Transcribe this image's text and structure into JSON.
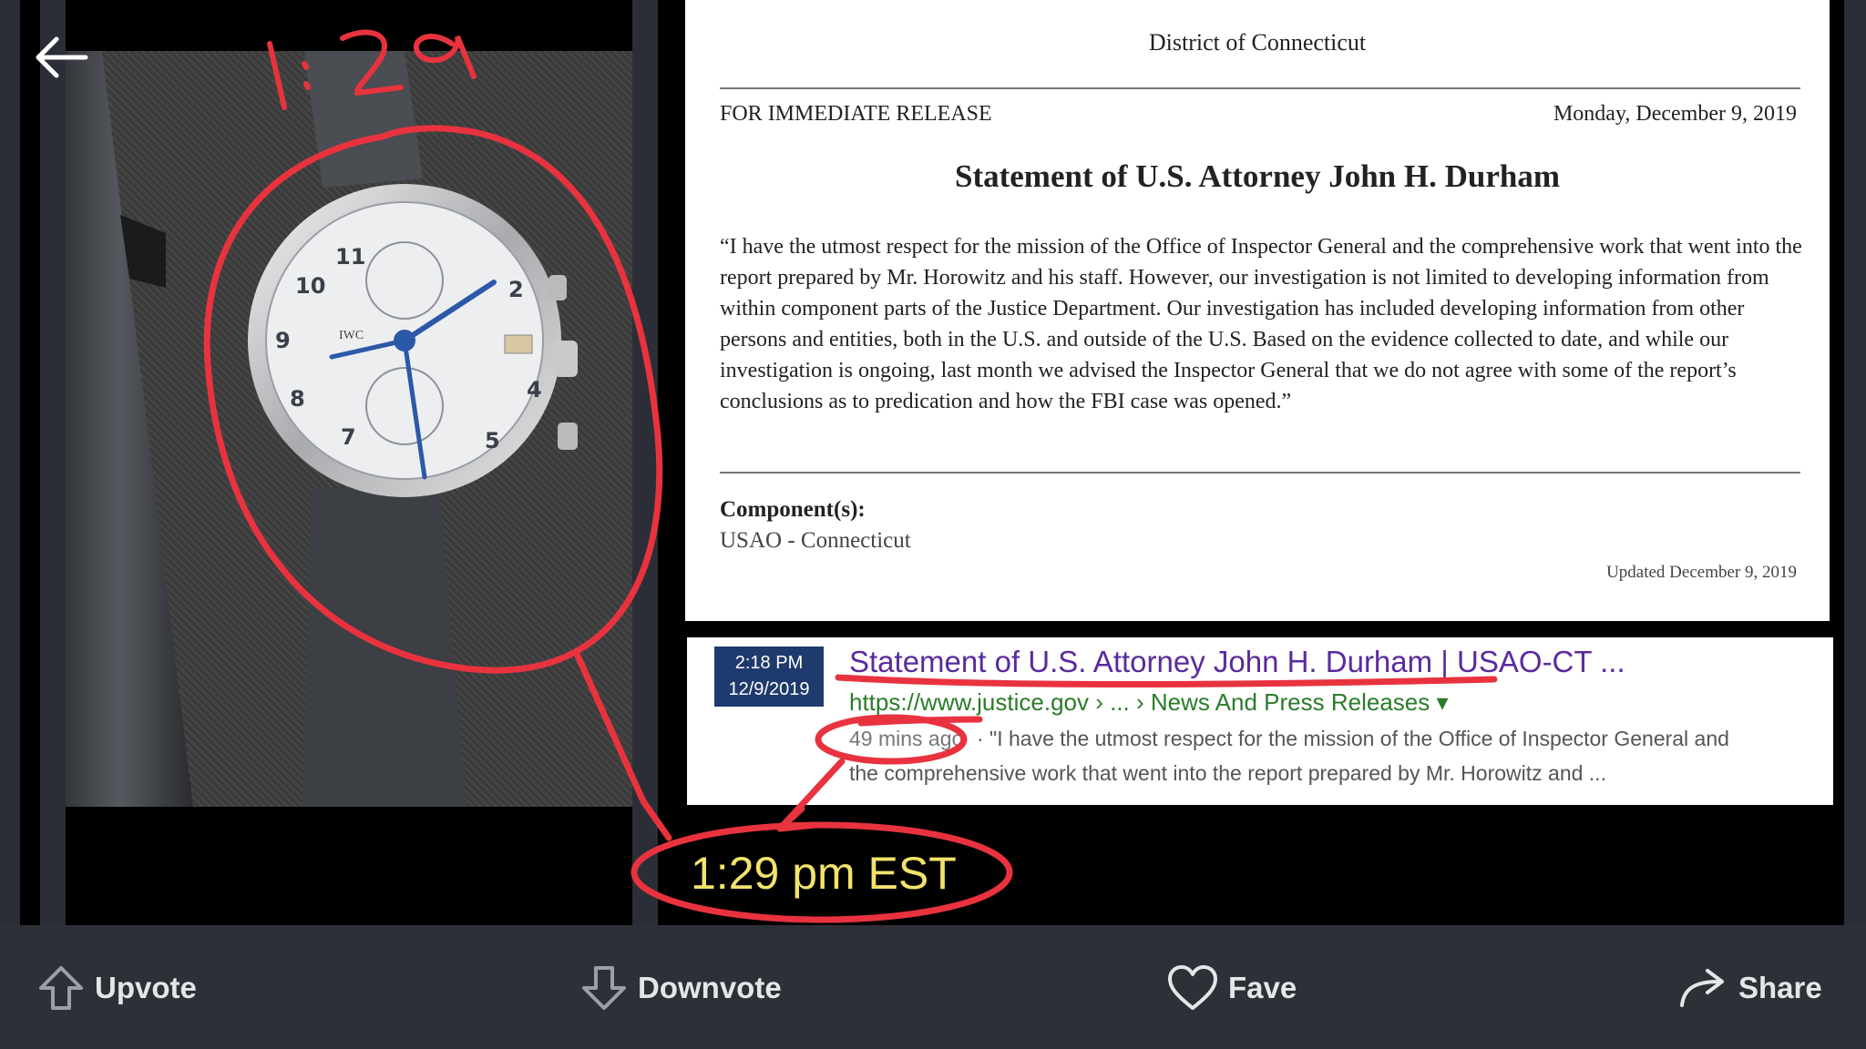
{
  "handwritten_time": "1:29",
  "press_release": {
    "office_line": "District of Connecticut",
    "release_label": "FOR IMMEDIATE RELEASE",
    "date": "Monday, December 9, 2019",
    "title": "Statement of U.S. Attorney John H. Durham",
    "body": "“I have the utmost respect for the mission of the Office of Inspector General and the comprehensive work that went into the report prepared by Mr. Horowitz and his staff.  However, our investigation is not limited to developing information from within component parts of the Justice Department.  Our investigation has included developing information from other persons and entities, both in the U.S. and outside of the U.S.  Based on the evidence collected to date, and while our investigation is ongoing, last month we advised the Inspector General that we do not agree with some of the report’s conclusions as to predication and how the FBI case was opened.”",
    "component_heading": "Component(s):",
    "component_value": "USAO - Connecticut",
    "updated": "Updated December 9, 2019"
  },
  "search_result": {
    "timestamp_time": "2:18 PM",
    "timestamp_date": "12/9/2019",
    "title": "Statement of U.S. Attorney John H. Durham | USAO-CT ...",
    "url": "https://www.justice.gov › ... › News And Press Releases ▾",
    "age": "49 mins ago",
    "snippet_line1": "· \"I have the utmost respect for the mission of the Office of Inspector General and",
    "snippet_line2": "the comprehensive work that went into the report prepared by Mr. Horowitz and ..."
  },
  "caption_time": "1:29 pm  EST",
  "watch": {
    "brand": "IWC",
    "dial_numbers": [
      "11",
      "10",
      "9",
      "8",
      "7",
      "5",
      "4",
      "2"
    ]
  },
  "actions": {
    "upvote": "Upvote",
    "downvote": "Downvote",
    "fave": "Fave",
    "share": "Share"
  },
  "colors": {
    "annotation_red": "#e8333f",
    "caption_yellow": "#f2e36b",
    "bar_background": "#2e3037",
    "link_purple": "#5a2b9d",
    "url_green": "#2a7c2a"
  },
  "icons": [
    "back-arrow-icon",
    "upvote-arrow-icon",
    "downvote-arrow-icon",
    "heart-icon",
    "share-arrow-icon"
  ]
}
